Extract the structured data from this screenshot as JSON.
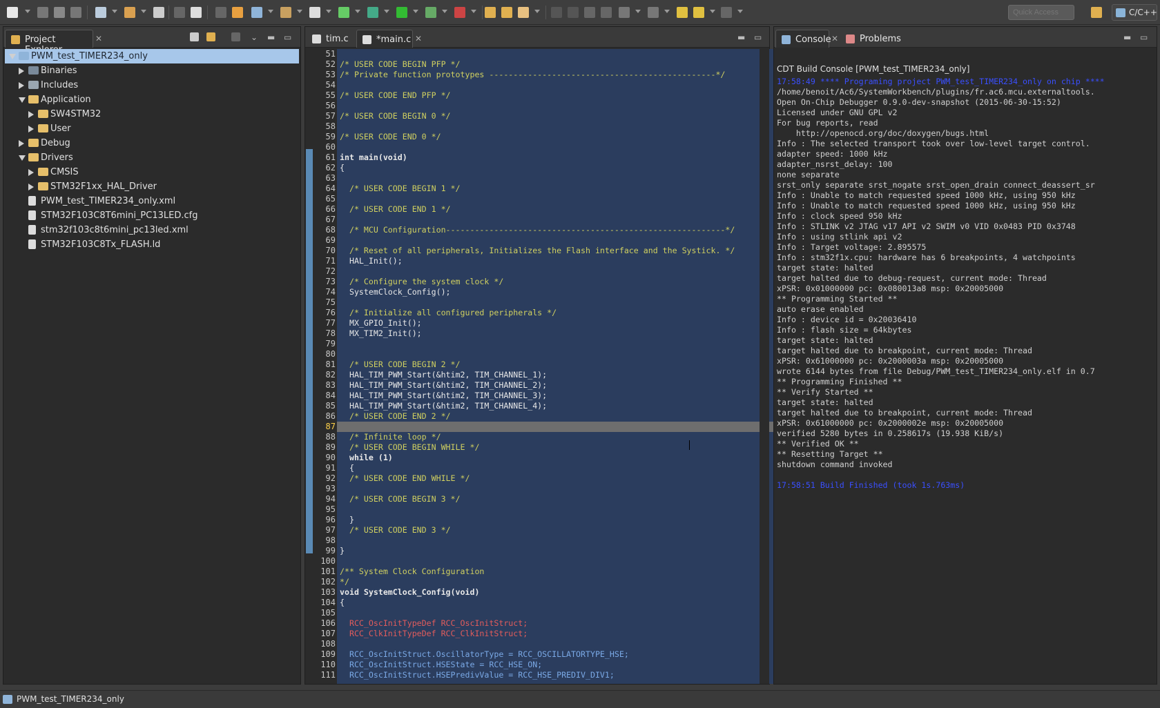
{
  "toolbar": {
    "quick_access_placeholder": "Quick Access",
    "perspective_label": "C/C++"
  },
  "project_explorer": {
    "tab_label": "Project Explorer",
    "items": [
      {
        "label": "PWM_test_TIMER234_only",
        "depth": 0,
        "twisty": "open",
        "icon": "project-icon",
        "selected": true
      },
      {
        "label": "Binaries",
        "depth": 1,
        "twisty": "closed",
        "icon": "binaries-icon"
      },
      {
        "label": "Includes",
        "depth": 1,
        "twisty": "closed",
        "icon": "includes-icon"
      },
      {
        "label": "Application",
        "depth": 1,
        "twisty": "open",
        "icon": "folder-icon"
      },
      {
        "label": "SW4STM32",
        "depth": 2,
        "twisty": "closed",
        "icon": "folder-icon"
      },
      {
        "label": "User",
        "depth": 2,
        "twisty": "closed",
        "icon": "folder-icon"
      },
      {
        "label": "Debug",
        "depth": 1,
        "twisty": "closed",
        "icon": "folder-icon"
      },
      {
        "label": "Drivers",
        "depth": 1,
        "twisty": "open",
        "icon": "folder-icon"
      },
      {
        "label": "CMSIS",
        "depth": 2,
        "twisty": "closed",
        "icon": "folder-icon"
      },
      {
        "label": "STM32F1xx_HAL_Driver",
        "depth": 2,
        "twisty": "closed",
        "icon": "folder-icon"
      },
      {
        "label": "PWM_test_TIMER234_only.xml",
        "depth": 1,
        "twisty": "none",
        "icon": "file-icon"
      },
      {
        "label": "STM32F103C8T6mini_PC13LED.cfg",
        "depth": 1,
        "twisty": "none",
        "icon": "file-icon"
      },
      {
        "label": "stm32f103c8t6mini_pc13led.xml",
        "depth": 1,
        "twisty": "none",
        "icon": "file-icon"
      },
      {
        "label": "STM32F103C8Tx_FLASH.ld",
        "depth": 1,
        "twisty": "none",
        "icon": "file-icon"
      }
    ]
  },
  "editor": {
    "tabs": [
      {
        "label": "tim.c",
        "active": false
      },
      {
        "label": "*main.c",
        "active": true
      }
    ],
    "current_line": "87",
    "lines": [
      {
        "n": "51",
        "t": ""
      },
      {
        "n": "52",
        "t": "/* USER CODE BEGIN PFP */",
        "c": "cm"
      },
      {
        "n": "53",
        "t": "/* Private function prototypes -----------------------------------------------*/",
        "c": "cm"
      },
      {
        "n": "54",
        "t": ""
      },
      {
        "n": "55",
        "t": "/* USER CODE END PFP */",
        "c": "cm"
      },
      {
        "n": "56",
        "t": ""
      },
      {
        "n": "57",
        "t": "/* USER CODE BEGIN 0 */",
        "c": "cm"
      },
      {
        "n": "58",
        "t": ""
      },
      {
        "n": "59",
        "t": "/* USER CODE END 0 */",
        "c": "cm"
      },
      {
        "n": "60",
        "t": ""
      },
      {
        "n": "61",
        "t": "int main(void)",
        "c": "kwl"
      },
      {
        "n": "62",
        "t": "{"
      },
      {
        "n": "63",
        "t": ""
      },
      {
        "n": "64",
        "t": "  /* USER CODE BEGIN 1 */",
        "c": "cm"
      },
      {
        "n": "65",
        "t": ""
      },
      {
        "n": "66",
        "t": "  /* USER CODE END 1 */",
        "c": "cm"
      },
      {
        "n": "67",
        "t": ""
      },
      {
        "n": "68",
        "t": "  /* MCU Configuration----------------------------------------------------------*/",
        "c": "cm"
      },
      {
        "n": "69",
        "t": ""
      },
      {
        "n": "70",
        "t": "  /* Reset of all peripherals, Initializes the Flash interface and the Systick. */",
        "c": "cm"
      },
      {
        "n": "71",
        "t": "  HAL_Init();"
      },
      {
        "n": "72",
        "t": ""
      },
      {
        "n": "73",
        "t": "  /* Configure the system clock */",
        "c": "cm"
      },
      {
        "n": "74",
        "t": "  SystemClock_Config();"
      },
      {
        "n": "75",
        "t": ""
      },
      {
        "n": "76",
        "t": "  /* Initialize all configured peripherals */",
        "c": "cm"
      },
      {
        "n": "77",
        "t": "  MX_GPIO_Init();"
      },
      {
        "n": "78",
        "t": "  MX_TIM2_Init();"
      },
      {
        "n": "79",
        "t": ""
      },
      {
        "n": "80",
        "t": ""
      },
      {
        "n": "81",
        "t": "  /* USER CODE BEGIN 2 */",
        "c": "cm"
      },
      {
        "n": "82",
        "t": "  HAL_TIM_PWM_Start(&htim2, TIM_CHANNEL_1);"
      },
      {
        "n": "83",
        "t": "  HAL_TIM_PWM_Start(&htim2, TIM_CHANNEL_2);"
      },
      {
        "n": "84",
        "t": "  HAL_TIM_PWM_Start(&htim2, TIM_CHANNEL_3);"
      },
      {
        "n": "85",
        "t": "  HAL_TIM_PWM_Start(&htim2, TIM_CHANNEL_4);"
      },
      {
        "n": "86",
        "t": "  /* USER CODE END 2 */",
        "c": "cm"
      },
      {
        "n": "87",
        "t": ""
      },
      {
        "n": "88",
        "t": "  /* Infinite loop */",
        "c": "cm"
      },
      {
        "n": "89",
        "t": "  /* USER CODE BEGIN WHILE */",
        "c": "cm"
      },
      {
        "n": "90",
        "t": "  while (1)",
        "c": "kwl"
      },
      {
        "n": "91",
        "t": "  {"
      },
      {
        "n": "92",
        "t": "  /* USER CODE END WHILE */",
        "c": "cm"
      },
      {
        "n": "93",
        "t": ""
      },
      {
        "n": "94",
        "t": "  /* USER CODE BEGIN 3 */",
        "c": "cm"
      },
      {
        "n": "95",
        "t": ""
      },
      {
        "n": "96",
        "t": "  }"
      },
      {
        "n": "97",
        "t": "  /* USER CODE END 3 */",
        "c": "cm"
      },
      {
        "n": "98",
        "t": ""
      },
      {
        "n": "99",
        "t": "}"
      },
      {
        "n": "100",
        "t": ""
      },
      {
        "n": "101",
        "t": "/** System Clock Configuration",
        "c": "cm"
      },
      {
        "n": "102",
        "t": "*/",
        "c": "cm"
      },
      {
        "n": "103",
        "t": "void SystemClock_Config(void)",
        "c": "kwl"
      },
      {
        "n": "104",
        "t": "{"
      },
      {
        "n": "105",
        "t": ""
      },
      {
        "n": "106",
        "t": "  RCC_OscInitTypeDef RCC_OscInitStruct;",
        "c": "ty"
      },
      {
        "n": "107",
        "t": "  RCC_ClkInitTypeDef RCC_ClkInitStruct;",
        "c": "ty"
      },
      {
        "n": "108",
        "t": ""
      },
      {
        "n": "109",
        "t": "  RCC_OscInitStruct.OscillatorType = RCC_OSCILLATORTYPE_HSE;",
        "c": "fld"
      },
      {
        "n": "110",
        "t": "  RCC_OscInitStruct.HSEState = RCC_HSE_ON;",
        "c": "fld"
      },
      {
        "n": "111",
        "t": "  RCC_OscInitStruct.HSEPredivValue = RCC_HSE_PREDIV_DIV1;",
        "c": "fld"
      }
    ]
  },
  "console": {
    "tab_label": "Console",
    "problems_label": "Problems",
    "title": "CDT Build Console [PWM_test_TIMER234_only]",
    "lines": [
      {
        "t": "17:58:49 **** Programing project PWM_test_TIMER234_only on chip ****",
        "blue": true
      },
      {
        "t": "/home/benoit/Ac6/SystemWorkbench/plugins/fr.ac6.mcu.externaltools."
      },
      {
        "t": "Open On-Chip Debugger 0.9.0-dev-snapshot (2015-06-30-15:52)"
      },
      {
        "t": "Licensed under GNU GPL v2"
      },
      {
        "t": "For bug reports, read"
      },
      {
        "t": "    http://openocd.org/doc/doxygen/bugs.html"
      },
      {
        "t": "Info : The selected transport took over low-level target control."
      },
      {
        "t": "adapter speed: 1000 kHz"
      },
      {
        "t": "adapter_nsrst_delay: 100"
      },
      {
        "t": "none separate"
      },
      {
        "t": "srst_only separate srst_nogate srst_open_drain connect_deassert_sr"
      },
      {
        "t": "Info : Unable to match requested speed 1000 kHz, using 950 kHz"
      },
      {
        "t": "Info : Unable to match requested speed 1000 kHz, using 950 kHz"
      },
      {
        "t": "Info : clock speed 950 kHz"
      },
      {
        "t": "Info : STLINK v2 JTAG v17 API v2 SWIM v0 VID 0x0483 PID 0x3748"
      },
      {
        "t": "Info : using stlink api v2"
      },
      {
        "t": "Info : Target voltage: 2.895575"
      },
      {
        "t": "Info : stm32f1x.cpu: hardware has 6 breakpoints, 4 watchpoints"
      },
      {
        "t": "target state: halted"
      },
      {
        "t": "target halted due to debug-request, current mode: Thread"
      },
      {
        "t": "xPSR: 0x01000000 pc: 0x080013a8 msp: 0x20005000"
      },
      {
        "t": "** Programming Started **"
      },
      {
        "t": "auto erase enabled"
      },
      {
        "t": "Info : device id = 0x20036410"
      },
      {
        "t": "Info : flash size = 64kbytes"
      },
      {
        "t": "target state: halted"
      },
      {
        "t": "target halted due to breakpoint, current mode: Thread"
      },
      {
        "t": "xPSR: 0x61000000 pc: 0x2000003a msp: 0x20005000"
      },
      {
        "t": "wrote 6144 bytes from file Debug/PWM_test_TIMER234_only.elf in 0.7"
      },
      {
        "t": "** Programming Finished **"
      },
      {
        "t": "** Verify Started **"
      },
      {
        "t": "target state: halted"
      },
      {
        "t": "target halted due to breakpoint, current mode: Thread"
      },
      {
        "t": "xPSR: 0x61000000 pc: 0x2000002e msp: 0x20005000"
      },
      {
        "t": "verified 5280 bytes in 0.258617s (19.938 KiB/s)"
      },
      {
        "t": "** Verified OK **"
      },
      {
        "t": "** Resetting Target **"
      },
      {
        "t": "shutdown command invoked"
      },
      {
        "t": ""
      },
      {
        "t": "17:58:51 Build Finished (took 1s.763ms)",
        "blue": true
      }
    ]
  },
  "status_bar": {
    "text": "PWM_test_TIMER234_only"
  },
  "colors": {
    "editor_selection": "#2b3d5e",
    "comment": "#d0d060",
    "type": "#e25c5c",
    "console_link": "#3a4fff",
    "tree_selection": "#a7c7ea"
  }
}
